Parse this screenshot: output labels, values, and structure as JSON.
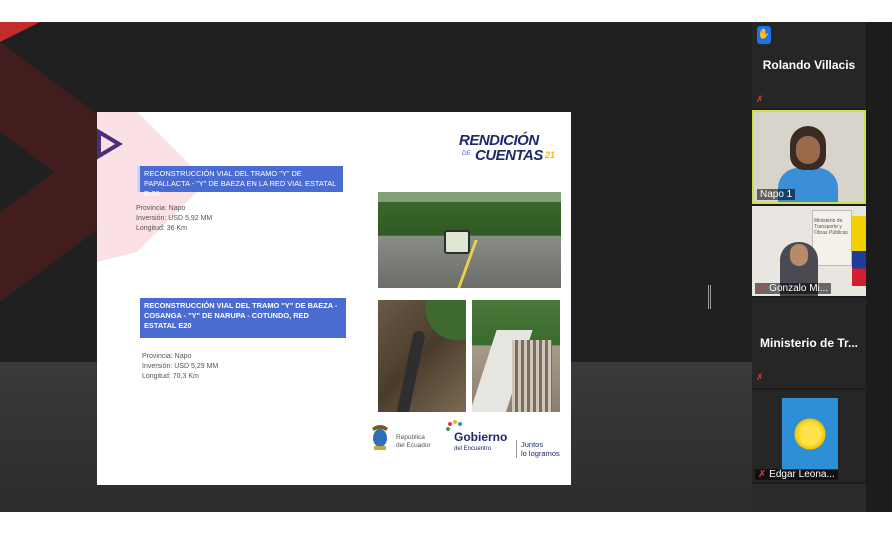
{
  "slide": {
    "logo": {
      "line1": "RENDICIÓN",
      "line2": "CUENTAS",
      "small": "DE",
      "year": "21"
    },
    "projects": [
      {
        "title": "RECONSTRUCCIÓN VIAL DEL TRAMO \"Y\" DE PAPALLACTA - \"Y\" DE BAEZA EN LA RED VIAL ESTATAL E-20",
        "provincia": "Provincia: Napo",
        "inversion": "Inversión: USD 5,92 MM",
        "longitud": "Longitud: 36 Km"
      },
      {
        "title": "RECONSTRUCCIÓN VIAL DEL TRAMO \"Y\" DE BAEZA - COSANGA - \"Y\" DE NARUPA - COTUNDO, RED ESTATAL E20",
        "provincia": "Provincia: Napo",
        "inversion": "Inversión: USD 5,29 MM",
        "longitud": "Longitud: 70,3 Km"
      }
    ],
    "footer": {
      "republica": "República",
      "ecuador": "del Ecuador",
      "gobierno": "Gobierno",
      "encuentro": "del Encuentro",
      "juntos1": "Juntos",
      "juntos2": "lo logramos"
    }
  },
  "participants": {
    "rolando": {
      "name": "Rolando Villacis"
    },
    "napo": {
      "name": "Napo 1"
    },
    "gonzalo": {
      "name": "Gonzalo Mi...",
      "poster_text": "Ministerio de Transporte y Obras Públicas"
    },
    "ministerio": {
      "name": "Ministerio de Tr..."
    },
    "edgar": {
      "name": "Edgar Leona..."
    }
  },
  "colors": {
    "accent_active_speaker": "#cfe04a",
    "raise_hand": "#1a73e8",
    "mic_off": "#e23b3b",
    "slide_title_bg": "#4a6bd0"
  },
  "icons": [
    "raise-hand-icon",
    "mic-off-icon"
  ]
}
